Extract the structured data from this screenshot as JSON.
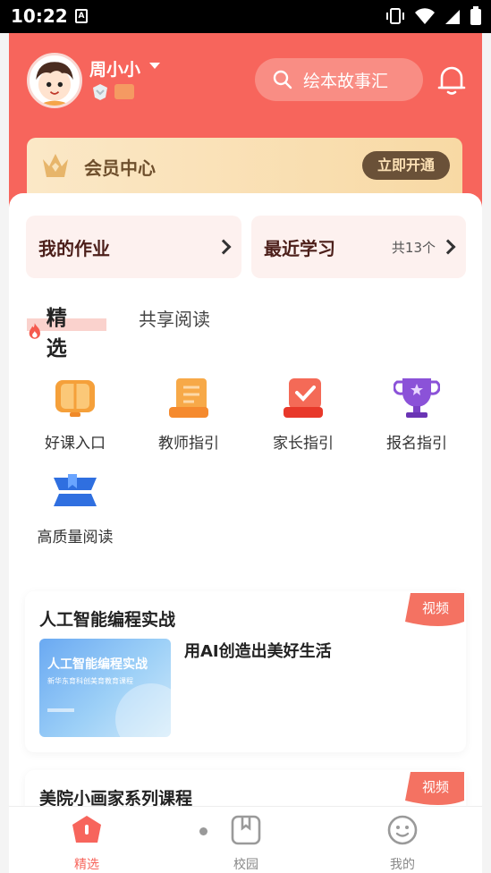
{
  "status": {
    "time": "10:22"
  },
  "header": {
    "username": "周小小",
    "search_placeholder": "绘本故事汇"
  },
  "vip": {
    "title": "会员中心",
    "button": "立即开通"
  },
  "quick": {
    "homework": "我的作业",
    "recent": "最近学习",
    "recent_count": "共13个"
  },
  "tabs": {
    "active": "精选",
    "inactive": "共享阅读"
  },
  "grid": [
    {
      "label": "好课入口",
      "icon": "book-icon"
    },
    {
      "label": "教师指引",
      "icon": "scroll-icon"
    },
    {
      "label": "家长指引",
      "icon": "checkmark-card-icon"
    },
    {
      "label": "报名指引",
      "icon": "trophy-icon"
    },
    {
      "label": "高质量阅读",
      "icon": "ribbon-book-icon"
    }
  ],
  "courses": [
    {
      "title": "人工智能编程实战",
      "tag": "视频",
      "thumb_title": "人工智能编程实战",
      "thumb_sub": "新华东育科创美育教育课程",
      "subtitle": "用AI创造出美好生活"
    },
    {
      "title": "美院小画家系列课程",
      "tag": "视频"
    }
  ],
  "nav": {
    "home": "精选",
    "campus": "校园",
    "mine": "我的"
  },
  "colors": {
    "brand": "#f7655c",
    "vip_bg": "#f8d9a4",
    "vip_btn": "#6a5138"
  }
}
